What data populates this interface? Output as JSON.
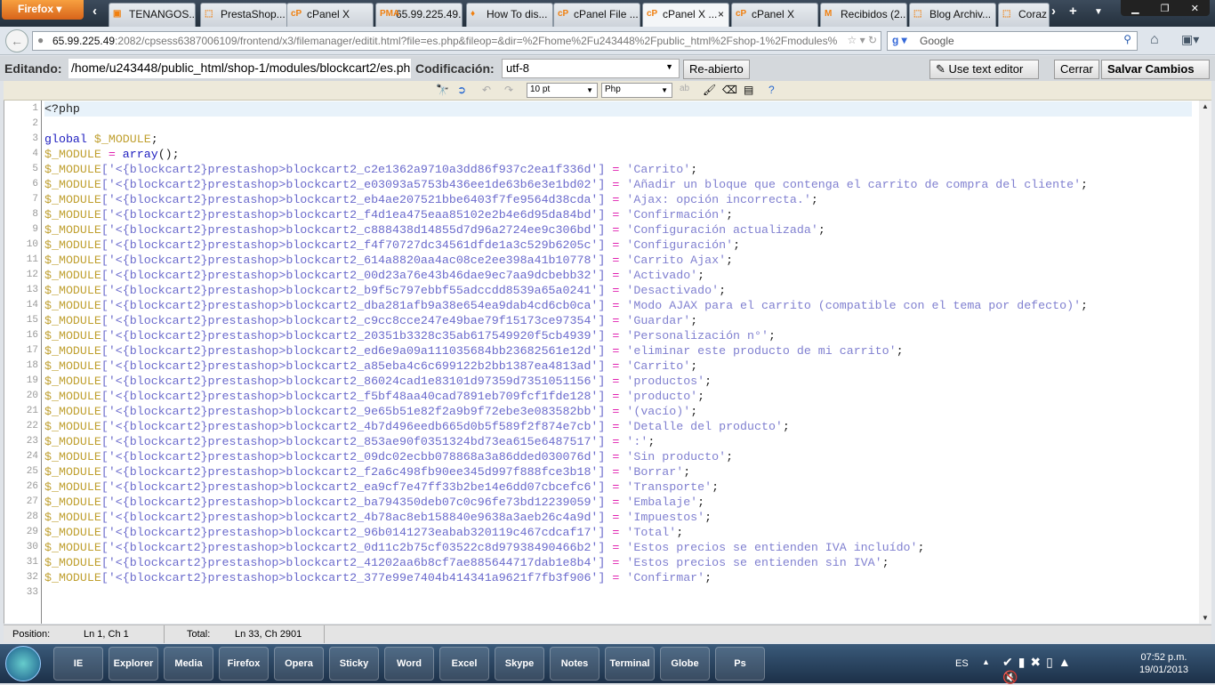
{
  "browser": {
    "menu_label": "Firefox ▾",
    "tabs": [
      {
        "icon": "▣",
        "label": "TENANGOS..."
      },
      {
        "icon": "⬚",
        "label": "PrestaShop..."
      },
      {
        "icon": "cP",
        "label": "cPanel X"
      },
      {
        "icon": "PMA",
        "label": "65.99.225.49..."
      },
      {
        "icon": "♦",
        "label": "How To dis..."
      },
      {
        "icon": "cP",
        "label": "cPanel File ..."
      },
      {
        "icon": "cP",
        "label": "cPanel X ...",
        "close": "×",
        "active": true
      },
      {
        "icon": "cP",
        "label": "cPanel X"
      },
      {
        "icon": "M",
        "label": "Recibidos (2..."
      },
      {
        "icon": "⬚",
        "label": "Blog Archiv..."
      },
      {
        "icon": "⬚",
        "label": "Coraz"
      }
    ],
    "url_host": "65.99.225.49",
    "url_rest": ":2082/cpsess6387006109/frontend/x3/filemanager/editit.html?file=es.php&fileop=&dir=%2Fhome%2Fu243448%2Fpublic_html%2Fshop-1%2Fmodules%",
    "search_placeholder": "Google"
  },
  "editor_bar": {
    "editing_label": "Editando:",
    "path": "/home/u243448/public_html/shop-1/modules/blockcart2/es.php",
    "encoding_label": "Codificación:",
    "encoding": "utf-8",
    "reopen": "Re-abierto",
    "text_editor": "Use text editor",
    "close": "Cerrar",
    "save": "Salvar Cambios"
  },
  "toolbar": {
    "font_size": "10 pt",
    "syntax": "Php"
  },
  "code": {
    "lines": [
      "<?php",
      "",
      "global $_MODULE;",
      "$_MODULE = array();",
      "$_MODULE['<{blockcart2}prestashop>blockcart2_c2e1362a9710a3dd86f937c2ea1f336d'] = 'Carrito';",
      "$_MODULE['<{blockcart2}prestashop>blockcart2_e03093a5753b436ee1de63b6e3e1bd02'] = 'Añadir un bloque que contenga el carrito de compra del cliente';",
      "$_MODULE['<{blockcart2}prestashop>blockcart2_eb4ae207521bbe6403f7fe9564d38cda'] = 'Ajax: opción incorrecta.';",
      "$_MODULE['<{blockcart2}prestashop>blockcart2_f4d1ea475eaa85102e2b4e6d95da84bd'] = 'Confirmación';",
      "$_MODULE['<{blockcart2}prestashop>blockcart2_c888438d14855d7d96a2724ee9c306bd'] = 'Configuración actualizada';",
      "$_MODULE['<{blockcart2}prestashop>blockcart2_f4f70727dc34561dfde1a3c529b6205c'] = 'Configuración';",
      "$_MODULE['<{blockcart2}prestashop>blockcart2_614a8820aa4ac08ce2ee398a41b10778'] = 'Carrito Ajax';",
      "$_MODULE['<{blockcart2}prestashop>blockcart2_00d23a76e43b46dae9ec7aa9dcbebb32'] = 'Activado';",
      "$_MODULE['<{blockcart2}prestashop>blockcart2_b9f5c797ebbf55adccdd8539a65a0241'] = 'Desactivado';",
      "$_MODULE['<{blockcart2}prestashop>blockcart2_dba281afb9a38e654ea9dab4cd6cb0ca'] = 'Modo AJAX para el carrito (compatible con el tema por defecto)';",
      "$_MODULE['<{blockcart2}prestashop>blockcart2_c9cc8cce247e49bae79f15173ce97354'] = 'Guardar';",
      "$_MODULE['<{blockcart2}prestashop>blockcart2_20351b3328c35ab617549920f5cb4939'] = 'Personalización n°';",
      "$_MODULE['<{blockcart2}prestashop>blockcart2_ed6e9a09a111035684bb23682561e12d'] = 'eliminar este producto de mi carrito';",
      "$_MODULE['<{blockcart2}prestashop>blockcart2_a85eba4c6c699122b2bb1387ea4813ad'] = 'Carrito';",
      "$_MODULE['<{blockcart2}prestashop>blockcart2_86024cad1e83101d97359d7351051156'] = 'productos';",
      "$_MODULE['<{blockcart2}prestashop>blockcart2_f5bf48aa40cad7891eb709fcf1fde128'] = 'producto';",
      "$_MODULE['<{blockcart2}prestashop>blockcart2_9e65b51e82f2a9b9f72ebe3e083582bb'] = '(vacío)';",
      "$_MODULE['<{blockcart2}prestashop>blockcart2_4b7d496eedb665d0b5f589f2f874e7cb'] = 'Detalle del producto';",
      "$_MODULE['<{blockcart2}prestashop>blockcart2_853ae90f0351324bd73ea615e6487517'] = ':';",
      "$_MODULE['<{blockcart2}prestashop>blockcart2_09dc02ecbb078868a3a86dded030076d'] = 'Sin producto';",
      "$_MODULE['<{blockcart2}prestashop>blockcart2_f2a6c498fb90ee345d997f888fce3b18'] = 'Borrar';",
      "$_MODULE['<{blockcart2}prestashop>blockcart2_ea9cf7e47ff33b2be14e6dd07cbcefc6'] = 'Transporte';",
      "$_MODULE['<{blockcart2}prestashop>blockcart2_ba794350deb07c0c96fe73bd12239059'] = 'Embalaje';",
      "$_MODULE['<{blockcart2}prestashop>blockcart2_4b78ac8eb158840e9638a3aeb26c4a9d'] = 'Impuestos';",
      "$_MODULE['<{blockcart2}prestashop>blockcart2_96b0141273eabab320119c467cdcaf17'] = 'Total';",
      "$_MODULE['<{blockcart2}prestashop>blockcart2_0d11c2b75cf03522c8d97938490466b2'] = 'Estos precios se entienden IVA incluído';",
      "$_MODULE['<{blockcart2}prestashop>blockcart2_41202aa6b8cf7ae885644717dab1e8b4'] = 'Estos precios se entienden sin IVA';",
      "$_MODULE['<{blockcart2}prestashop>blockcart2_377e99e7404b414341a9621f7fb3f906'] = 'Confirmar';",
      ""
    ]
  },
  "status": {
    "position_label": "Position:",
    "position": "Ln 1, Ch 1",
    "total_label": "Total:",
    "total": "Ln 33, Ch 2901"
  },
  "taskbar": {
    "icons": [
      "IE",
      "Explorer",
      "Media",
      "Firefox",
      "Opera",
      "Sticky",
      "Word",
      "Excel",
      "Skype",
      "Notes",
      "Terminal",
      "Globe",
      "Ps"
    ],
    "lang": "ES",
    "time": "07:52 p.m.",
    "date": "19/01/2013"
  }
}
